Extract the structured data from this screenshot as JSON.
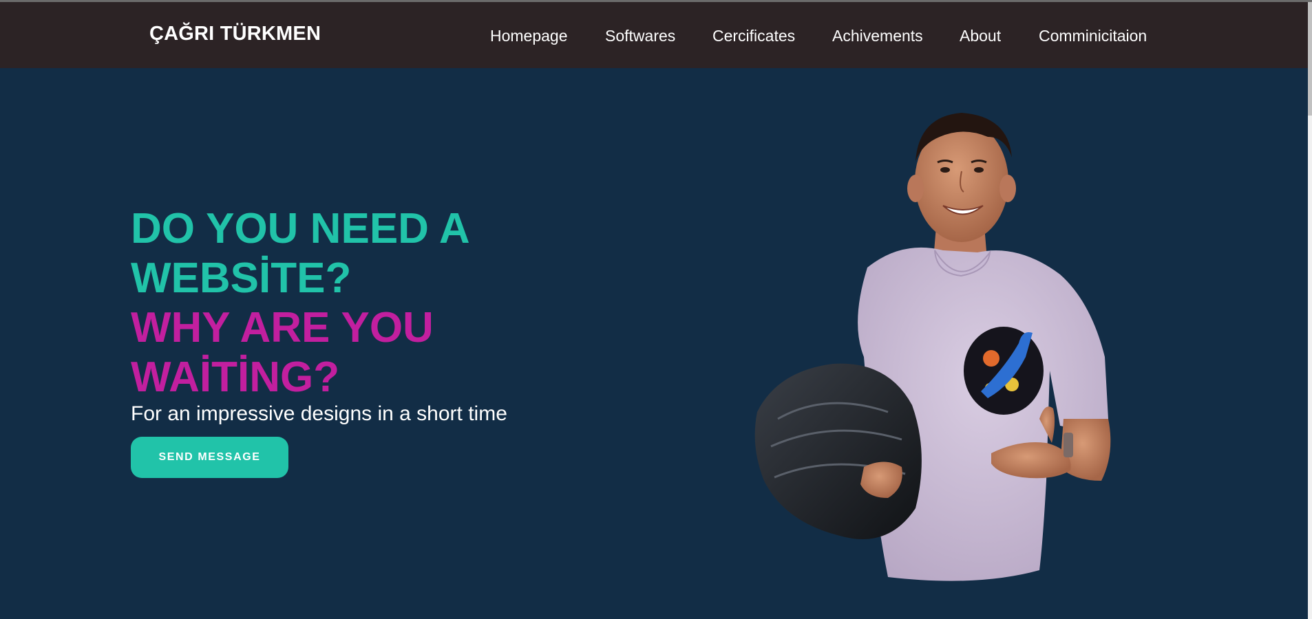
{
  "nav": {
    "brand": "ÇAĞRI TÜRKMEN",
    "links": [
      "Homepage",
      "Softwares",
      "Cercificates",
      "Achivements",
      "About",
      "Comminicitaion"
    ]
  },
  "hero": {
    "line1": "DO YOU NEED A",
    "line2": "WEBSİTE?",
    "line3": "WHY ARE YOU",
    "line4": "WAİTİNG?",
    "tagline": "For an impressive designs in a short time",
    "cta_label": "SEND MESSAGE"
  },
  "colors": {
    "navbar": "#2c2325",
    "background": "#122d46",
    "accent_teal": "#21c3a9",
    "accent_magenta": "#c21f9f"
  },
  "icons": [
    "portrait-photo"
  ]
}
